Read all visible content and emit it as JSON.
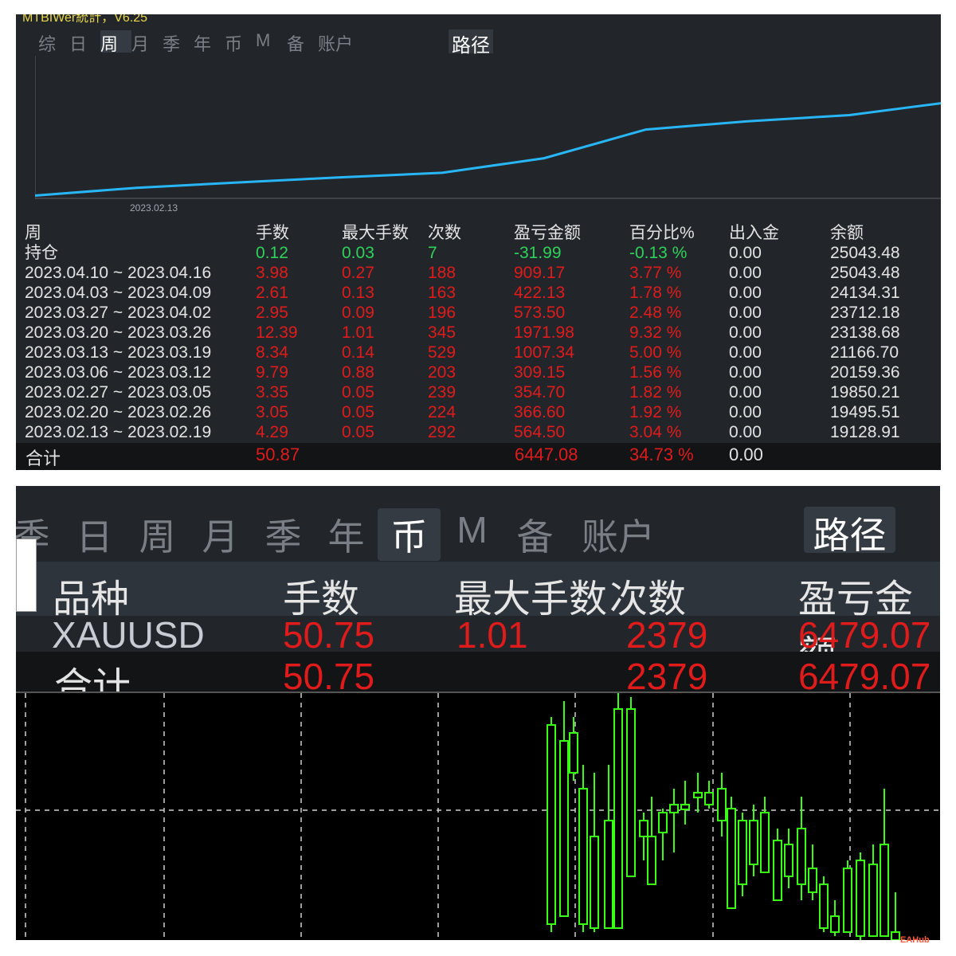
{
  "top_panel": {
    "title": "MTBIWer統計，V6.25",
    "tabs": [
      "综",
      "日",
      "周",
      "月",
      "季",
      "年",
      "币",
      "M",
      "备",
      "账户"
    ],
    "active_tab": "周",
    "path_button": "路径",
    "chart_date_label": "2023.02.13",
    "headers": {
      "period": "周",
      "lots": "手数",
      "max_lots": "最大手数",
      "count": "次数",
      "profit": "盈亏金额",
      "percent": "百分比%",
      "deposit": "出入金",
      "balance": "余额"
    },
    "position": {
      "label": "持仓",
      "lots": "0.12",
      "max_lots": "0.03",
      "count": "7",
      "profit": "-31.99",
      "percent": "-0.13 %",
      "deposit": "0.00",
      "balance": "25043.48"
    },
    "rows": [
      {
        "period": "2023.04.10 ~ 2023.04.16",
        "lots": "3.98",
        "max_lots": "0.27",
        "count": "188",
        "profit": "909.17",
        "percent": "3.77 %",
        "deposit": "0.00",
        "balance": "25043.48"
      },
      {
        "period": "2023.04.03 ~ 2023.04.09",
        "lots": "2.61",
        "max_lots": "0.13",
        "count": "163",
        "profit": "422.13",
        "percent": "1.78 %",
        "deposit": "0.00",
        "balance": "24134.31"
      },
      {
        "period": "2023.03.27 ~ 2023.04.02",
        "lots": "2.95",
        "max_lots": "0.09",
        "count": "196",
        "profit": "573.50",
        "percent": "2.48 %",
        "deposit": "0.00",
        "balance": "23712.18"
      },
      {
        "period": "2023.03.20 ~ 2023.03.26",
        "lots": "12.39",
        "max_lots": "1.01",
        "count": "345",
        "profit": "1971.98",
        "percent": "9.32 %",
        "deposit": "0.00",
        "balance": "23138.68"
      },
      {
        "period": "2023.03.13 ~ 2023.03.19",
        "lots": "8.34",
        "max_lots": "0.14",
        "count": "529",
        "profit": "1007.34",
        "percent": "5.00 %",
        "deposit": "0.00",
        "balance": "21166.70"
      },
      {
        "period": "2023.03.06 ~ 2023.03.12",
        "lots": "9.79",
        "max_lots": "0.88",
        "count": "203",
        "profit": "309.15",
        "percent": "1.56 %",
        "deposit": "0.00",
        "balance": "20159.36"
      },
      {
        "period": "2023.02.27 ~ 2023.03.05",
        "lots": "3.35",
        "max_lots": "0.05",
        "count": "239",
        "profit": "354.70",
        "percent": "1.82 %",
        "deposit": "0.00",
        "balance": "19850.21"
      },
      {
        "period": "2023.02.20 ~ 2023.02.26",
        "lots": "3.05",
        "max_lots": "0.05",
        "count": "224",
        "profit": "366.60",
        "percent": "1.92 %",
        "deposit": "0.00",
        "balance": "19495.51"
      },
      {
        "period": "2023.02.13 ~ 2023.02.19",
        "lots": "4.29",
        "max_lots": "0.05",
        "count": "292",
        "profit": "564.50",
        "percent": "3.04 %",
        "deposit": "0.00",
        "balance": "19128.91"
      }
    ],
    "total": {
      "label": "合计",
      "lots": "50.87",
      "profit": "6447.08",
      "percent": "34.73 %",
      "deposit": "0.00"
    },
    "balance_curve": [
      18590,
      19128.91,
      19495.51,
      19850.21,
      20159.36,
      21166.7,
      23138.68,
      23712.18,
      24134.31,
      25043.48
    ]
  },
  "bottom_panel": {
    "tabs": [
      "季",
      "日",
      "周",
      "月",
      "季",
      "年",
      "币",
      "M",
      "备",
      "账户"
    ],
    "active_tab": "币",
    "path_button": "路径",
    "headers": {
      "symbol": "品种",
      "lots": "手数",
      "max_lots": "最大手数",
      "count": "次数",
      "profit": "盈亏金额"
    },
    "row": {
      "symbol": "XAUUSD",
      "lots": "50.75",
      "max_lots": "1.01",
      "count": "2379",
      "profit": "6479.07"
    },
    "total": {
      "label": "合计",
      "lots": "50.75",
      "count": "2379",
      "profit": "6479.07"
    }
  },
  "colors": {
    "bg": "#22262b",
    "positive": "#2fd15a",
    "negative": "#e01b1b",
    "curve": "#29b6f6",
    "candle": "#39ff14"
  },
  "watermark": "EAHub"
}
